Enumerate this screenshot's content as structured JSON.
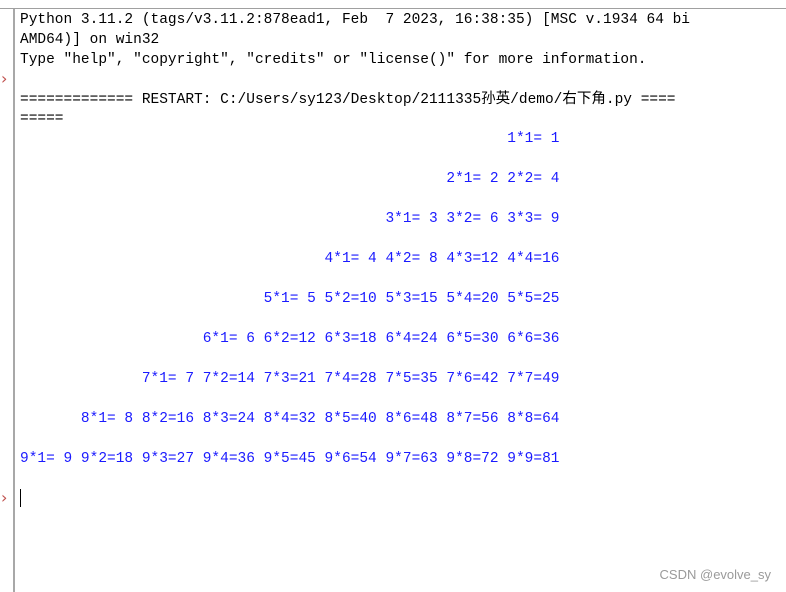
{
  "shell": {
    "banner_lines": [
      "Python 3.11.2 (tags/v3.11.2:878ead1, Feb  7 2023, 16:38:35) [MSC v.1934 64 bi",
      "AMD64)] on win32",
      "Type \"help\", \"copyright\", \"credits\" or \"license()\" for more information."
    ],
    "restart_lines": [
      "============= RESTART: C:/Users/sy123/Desktop/2111335孙英/demo/右下角.py ====",
      "====="
    ],
    "output_lines": [
      "                                                        1*1= 1",
      "                                                 2*1= 2 2*2= 4",
      "                                          3*1= 3 3*2= 6 3*3= 9",
      "                                   4*1= 4 4*2= 8 4*3=12 4*4=16",
      "                            5*1= 5 5*2=10 5*3=15 5*4=20 5*5=25",
      "                     6*1= 6 6*2=12 6*3=18 6*4=24 6*5=30 6*6=36",
      "              7*1= 7 7*2=14 7*3=21 7*4=28 7*5=35 7*6=42 7*7=49",
      "       8*1= 8 8*2=16 8*3=24 8*4=32 8*5=40 8*6=48 8*7=56 8*8=64",
      "9*1= 9 9*2=18 9*3=27 9*4=36 9*5=45 9*6=54 9*7=63 9*8=72 9*9=81"
    ],
    "prompt_icon": "chevron-right-icon",
    "prompt_glyph": "›"
  },
  "colors": {
    "output_text": "#1a1aff",
    "prompt_marker": "#c0504d",
    "watermark": "#9a9a9a"
  },
  "watermark": "CSDN @evolve_sy"
}
